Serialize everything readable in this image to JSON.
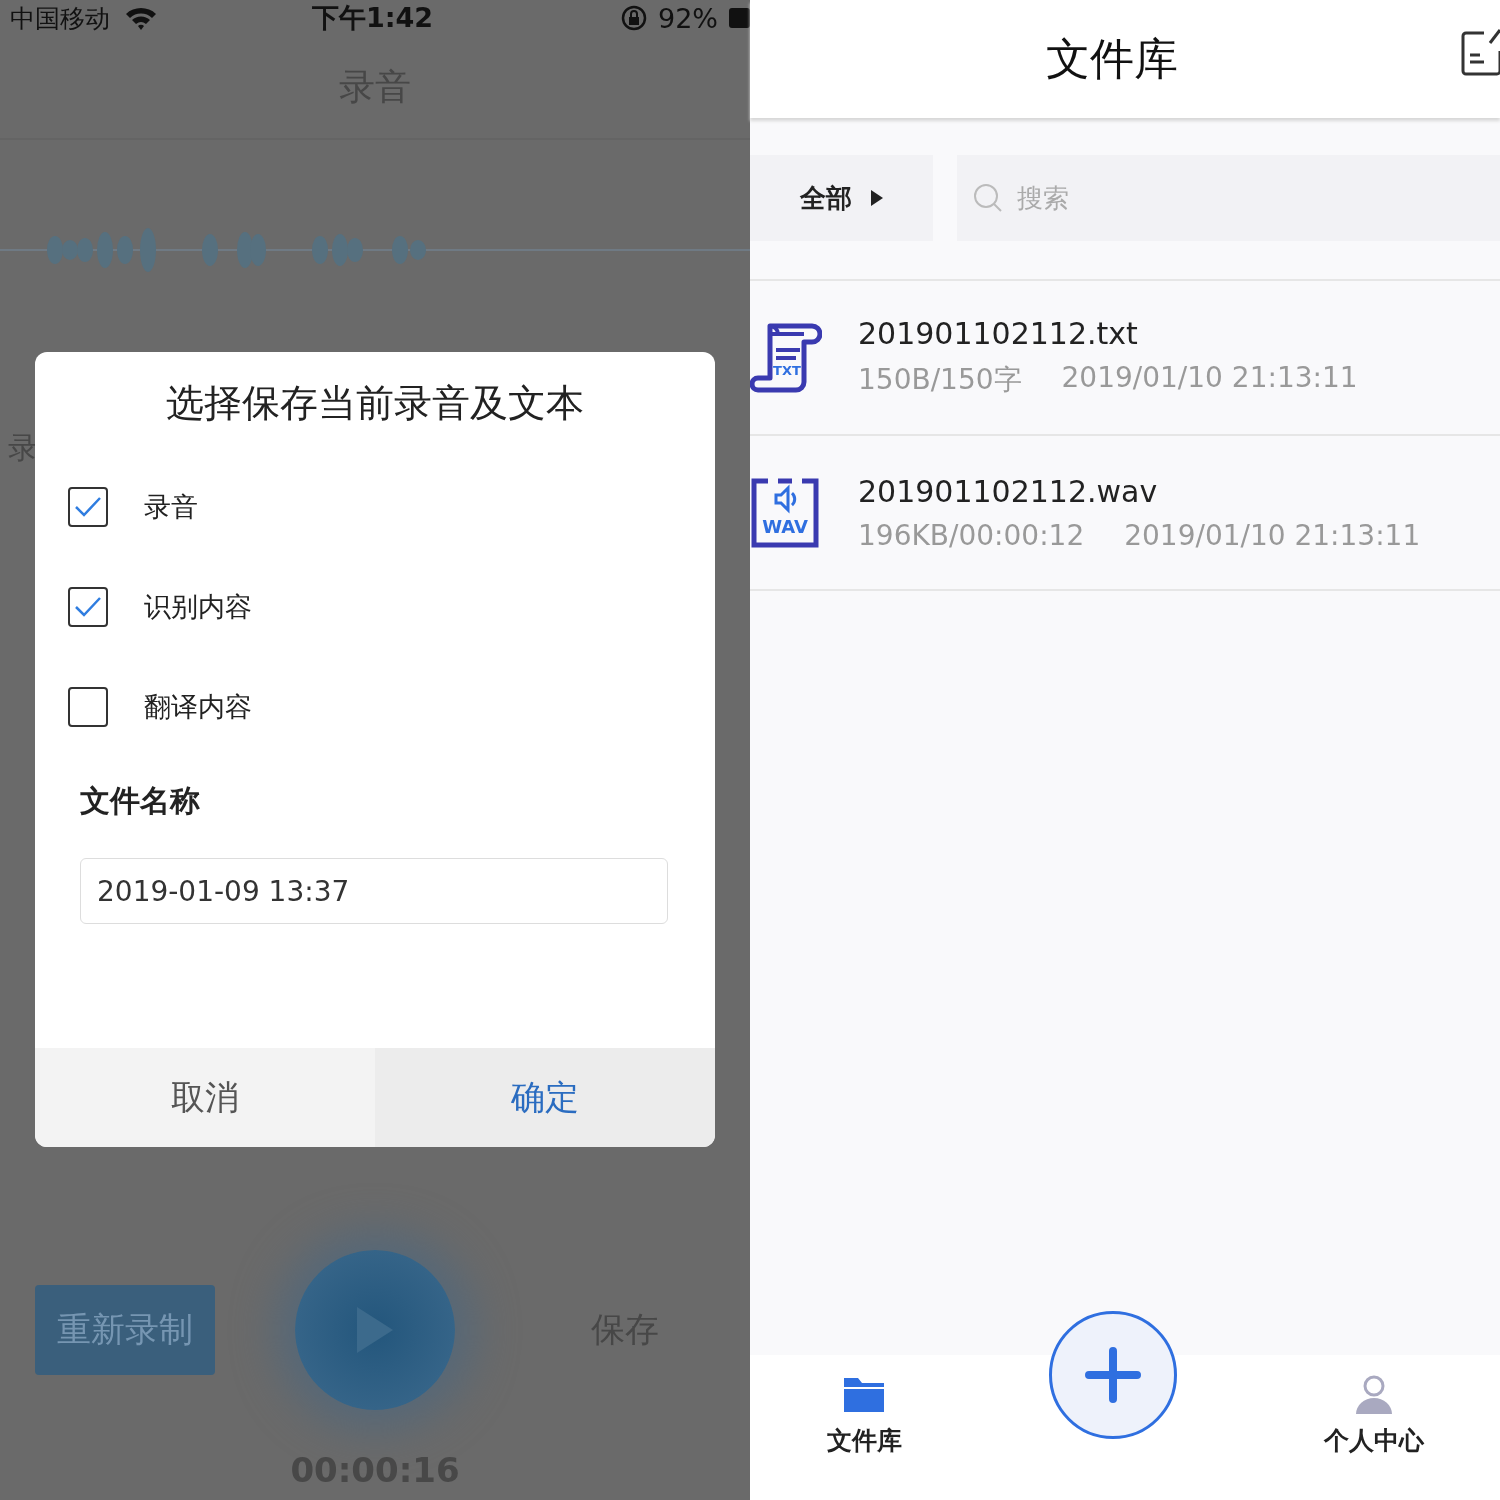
{
  "left_screen": {
    "status_bar": {
      "carrier": "中国移动",
      "time": "下午1:42",
      "battery": "92%"
    },
    "background": {
      "title": "录音",
      "side_text": "录",
      "rerecord_button": "重新录制",
      "save_button": "保存",
      "timer": "00:00:16"
    },
    "dialog": {
      "title": "选择保存当前录音及文本",
      "options": [
        {
          "label": "录音",
          "checked": true
        },
        {
          "label": "识别内容",
          "checked": true
        },
        {
          "label": "翻译内容",
          "checked": false
        }
      ],
      "filename_label": "文件名称",
      "filename_value": "2019-01-09 13:37",
      "buttons": [
        {
          "label": "取消",
          "kind": "cancel"
        },
        {
          "label": "确定",
          "kind": "confirm"
        }
      ]
    }
  },
  "right_screen": {
    "title": "文件库",
    "filter": {
      "label": "全部"
    },
    "search": {
      "placeholder": "搜索"
    },
    "files": [
      {
        "name": "201901102112.txt",
        "kind": "txt",
        "icon_label": "TXT",
        "size": "150B/150字",
        "date": "2019/01/10 21:13:11"
      },
      {
        "name": "201901102112.wav",
        "kind": "wav",
        "icon_label": "WAV",
        "size": "196KB/00:00:12",
        "date": "2019/01/10 21:13:11"
      }
    ],
    "tabs": [
      {
        "label": "文件库",
        "kind": "folder",
        "selected": true
      },
      {
        "label": "个人中心",
        "kind": "person",
        "selected": false
      }
    ]
  }
}
